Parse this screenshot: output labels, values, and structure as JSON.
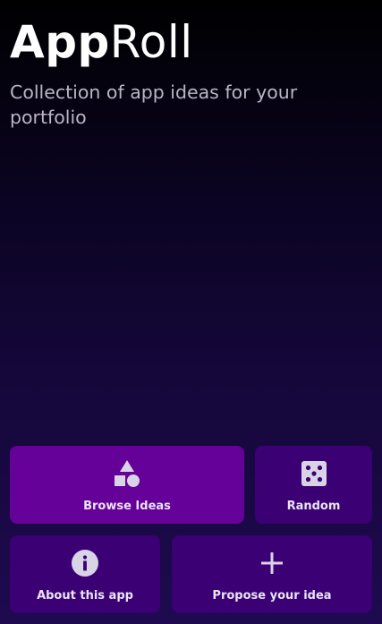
{
  "header": {
    "title_bold": "App",
    "title_light": "Roll",
    "subtitle": "Collection of app ideas for your portfolio"
  },
  "actions": [
    {
      "id": "browse",
      "label": "Browse Ideas",
      "icon": "shapes-icon"
    },
    {
      "id": "random",
      "label": "Random",
      "icon": "dice-icon"
    },
    {
      "id": "about",
      "label": "About this app",
      "icon": "info-icon"
    },
    {
      "id": "propose",
      "label": "Propose your idea",
      "icon": "plus-icon"
    }
  ],
  "colors": {
    "primary_card": "#650098",
    "secondary_card": "#3a0074",
    "icon": "#d9d3e6",
    "label": "#e9e4f3",
    "subtitle": "#b9b5c6"
  }
}
